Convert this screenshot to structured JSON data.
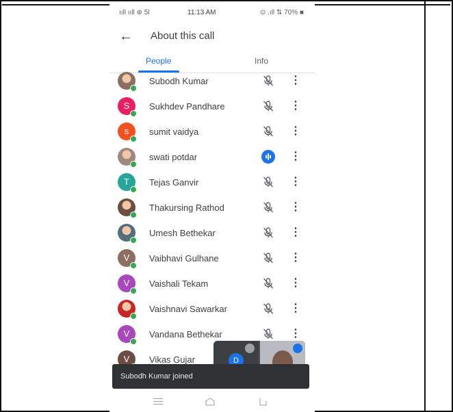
{
  "status_bar": {
    "left": "ııll ııll ⊕ 5l",
    "time": "11:13 AM",
    "right": "⊙ .ıll ⇅ 70% ■"
  },
  "header": {
    "back_icon": "←",
    "title": "About this call"
  },
  "tabs": [
    {
      "label": "People",
      "active": true
    },
    {
      "label": "Info",
      "active": false
    }
  ],
  "participants": [
    {
      "name": "Subodh Kumar",
      "initial": "",
      "avatar_color": "#8d6e63",
      "photo": true,
      "mic": "muted"
    },
    {
      "name": "Sukhdev Pandhare",
      "initial": "S",
      "avatar_color": "#e91e63",
      "photo": false,
      "mic": "muted"
    },
    {
      "name": "sumit vaidya",
      "initial": "s",
      "avatar_color": "#f4511e",
      "photo": false,
      "mic": "muted"
    },
    {
      "name": "swati potdar",
      "initial": "",
      "avatar_color": "#a1887f",
      "photo": true,
      "mic": "speaking"
    },
    {
      "name": "Tejas Ganvir",
      "initial": "T",
      "avatar_color": "#26a69a",
      "photo": false,
      "mic": "muted"
    },
    {
      "name": "Thakursing Rathod",
      "initial": "",
      "avatar_color": "#6d4c41",
      "photo": true,
      "mic": "muted"
    },
    {
      "name": "Umesh Bethekar",
      "initial": "",
      "avatar_color": "#546e7a",
      "photo": true,
      "mic": "muted"
    },
    {
      "name": "Vaibhavi Gulhane",
      "initial": "V",
      "avatar_color": "#8d6e63",
      "photo": false,
      "mic": "muted"
    },
    {
      "name": "Vaishali Tekam",
      "initial": "V",
      "avatar_color": "#ab47bc",
      "photo": false,
      "mic": "muted"
    },
    {
      "name": "Vaishnavi Sawarkar",
      "initial": "",
      "avatar_color": "#c62828",
      "photo": true,
      "mic": "muted"
    },
    {
      "name": "Vandana Bethekar",
      "initial": "V",
      "avatar_color": "#ab47bc",
      "photo": false,
      "mic": "muted"
    },
    {
      "name": "Vikas Gujar",
      "initial": "V",
      "avatar_color": "#6d4c41",
      "photo": false,
      "mic": "none"
    }
  ],
  "pip": {
    "avatar_initial": "D"
  },
  "snackbar": {
    "text": "Subodh Kumar joined"
  },
  "colors": {
    "accent": "#1a73e8",
    "presence": "#34a853"
  }
}
